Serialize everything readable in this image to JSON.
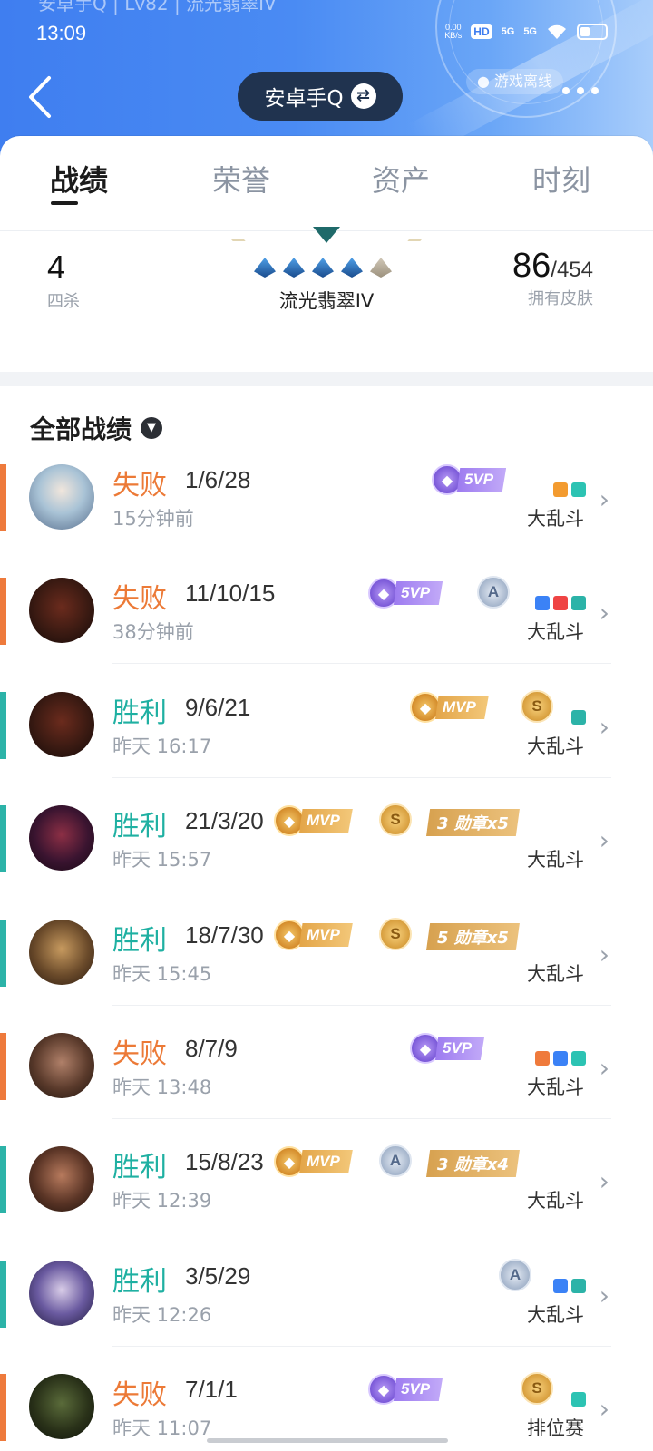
{
  "status_bar": {
    "ghost_title": "安卓手Q | Lv82 | 流光翡翠IV",
    "time": "13:09",
    "net_speed": "0.00 KB/s",
    "hd": "HD",
    "signal1": "5G",
    "signal2": "5G"
  },
  "header": {
    "account": "安卓手Q",
    "offline": "游戏离线"
  },
  "tabs": [
    {
      "label": "战绩",
      "active": true
    },
    {
      "label": "荣誉",
      "active": false
    },
    {
      "label": "资产",
      "active": false
    },
    {
      "label": "时刻",
      "active": false
    }
  ],
  "summary": {
    "quadra_value": "4",
    "quadra_label": "四杀",
    "rank_name": "流光翡翠IV",
    "skins_owned": "86",
    "skins_total": "/454",
    "skins_label": "拥有皮肤"
  },
  "section": {
    "title": "全部战绩"
  },
  "matches": [
    {
      "result": "失败",
      "outcome": "lose",
      "kda": "1/6/28",
      "time": "15分钟前",
      "mode": "大乱斗",
      "award": "5VP"
    },
    {
      "result": "失败",
      "outcome": "lose",
      "kda": "11/10/15",
      "time": "38分钟前",
      "mode": "大乱斗",
      "award": "5VP",
      "grade": "A"
    },
    {
      "result": "胜利",
      "outcome": "win",
      "kda": "9/6/21",
      "time": "昨天 16:17",
      "mode": "大乱斗",
      "award": "MVP",
      "grade": "S"
    },
    {
      "result": "胜利",
      "outcome": "win",
      "kda": "21/3/20",
      "time": "昨天 15:57",
      "mode": "大乱斗",
      "award": "MVP",
      "grade": "S",
      "medal": "3 勋章x5"
    },
    {
      "result": "胜利",
      "outcome": "win",
      "kda": "18/7/30",
      "time": "昨天 15:45",
      "mode": "大乱斗",
      "award": "MVP",
      "grade": "S",
      "medal": "5 勋章x5"
    },
    {
      "result": "失败",
      "outcome": "lose",
      "kda": "8/7/9",
      "time": "昨天 13:48",
      "mode": "大乱斗",
      "award": "5VP"
    },
    {
      "result": "胜利",
      "outcome": "win",
      "kda": "15/8/23",
      "time": "昨天 12:39",
      "mode": "大乱斗",
      "award": "MVP",
      "grade": "A",
      "medal": "3 勋章x4"
    },
    {
      "result": "胜利",
      "outcome": "win",
      "kda": "3/5/29",
      "time": "昨天 12:26",
      "mode": "大乱斗",
      "grade": "A"
    },
    {
      "result": "失败",
      "outcome": "lose",
      "kda": "7/1/1",
      "time": "昨天 11:07",
      "mode": "排位赛",
      "award": "5VP",
      "grade": "S"
    }
  ],
  "colors": {
    "lose": "#ee7a3c",
    "win": "#2cb3a8",
    "header_blue": "#3f7ef0",
    "pill_dark": "#20334f"
  }
}
